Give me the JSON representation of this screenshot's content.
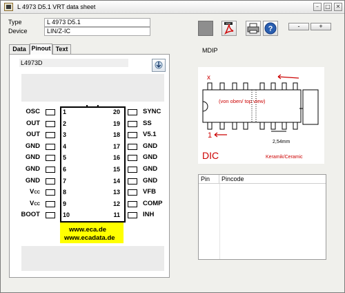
{
  "window": {
    "title": "L 4973 D5.1 VRT data sheet"
  },
  "fields": {
    "type_label": "Type",
    "type_value": "L 4973 D5.1",
    "device_label": "Device",
    "device_value": "LIN/Z-IC"
  },
  "toolbar": {
    "minus_label": "-",
    "plus_label": "+",
    "pdf_badge": "PDF"
  },
  "tabs": [
    {
      "label": "Data",
      "active": false
    },
    {
      "label": "Pinout",
      "active": true
    },
    {
      "label": "Text",
      "active": false
    }
  ],
  "chip": {
    "name": "L4973D",
    "left_pins": [
      {
        "num": "1",
        "name": "OSC"
      },
      {
        "num": "2",
        "name": "OUT"
      },
      {
        "num": "3",
        "name": "OUT"
      },
      {
        "num": "4",
        "name": "GND"
      },
      {
        "num": "5",
        "name": "GND"
      },
      {
        "num": "6",
        "name": "GND"
      },
      {
        "num": "7",
        "name": "GND"
      },
      {
        "num": "8",
        "name": "V",
        "sub": "CC"
      },
      {
        "num": "9",
        "name": "V",
        "sub": "CC"
      },
      {
        "num": "10",
        "name": "BOOT"
      }
    ],
    "right_pins": [
      {
        "num": "20",
        "name": "SYNC"
      },
      {
        "num": "19",
        "name": "SS"
      },
      {
        "num": "18",
        "name": "V5.1"
      },
      {
        "num": "17",
        "name": "GND"
      },
      {
        "num": "16",
        "name": "GND"
      },
      {
        "num": "15",
        "name": "GND"
      },
      {
        "num": "14",
        "name": "GND"
      },
      {
        "num": "13",
        "name": "VFB"
      },
      {
        "num": "12",
        "name": "COMP"
      },
      {
        "num": "11",
        "name": "INH"
      }
    ],
    "urls": [
      "www.eca.de",
      "www.ecadata.de"
    ]
  },
  "package": {
    "label": "MDIP",
    "x_mark": "x",
    "top_view": "(von oben/ top view)",
    "pin_one": "1",
    "pitch": "2,54mm",
    "type_text": "DIC",
    "material": "Keramik/Ceramic"
  },
  "pin_table": {
    "columns": [
      "Pin",
      "Pincode"
    ],
    "rows": []
  },
  "colors": {
    "accent_red": "#cc0000",
    "yellow": "#ffff00",
    "help_blue": "#2a5fb0"
  }
}
